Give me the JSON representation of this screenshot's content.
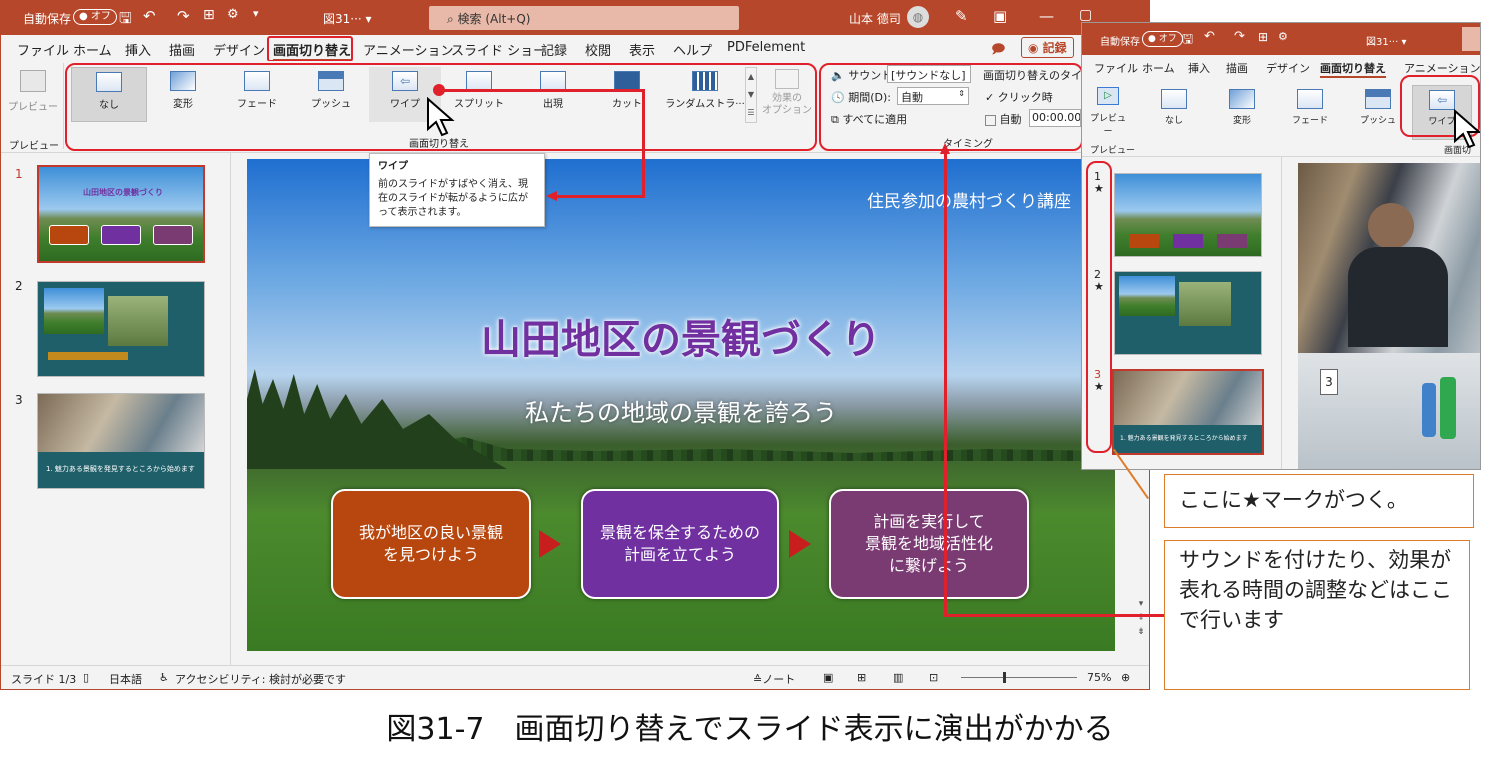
{
  "main": {
    "title_bar": {
      "autosave": "自動保存",
      "autosave_toggle": "● オフ",
      "filename": "図31··· ▾",
      "search": "検索 (Alt+Q)",
      "user": "山本 德司"
    },
    "menu": [
      "ファイル",
      "ホーム",
      "挿入",
      "描画",
      "デザイン",
      "画面切り替え",
      "アニメーション",
      "スライド ショー",
      "記録",
      "校閲",
      "表示",
      "ヘルプ",
      "PDFelement"
    ],
    "record_button": "◉ 記録",
    "ribbon": {
      "preview_label": "プレビュー",
      "preview_group": "プレビュー",
      "transitions": [
        "なし",
        "変形",
        "フェード",
        "プッシュ",
        "ワイプ",
        "スプリット",
        "出現",
        "カット",
        "ランダムストラ···"
      ],
      "effect_options": "効果の\nオプション",
      "transitions_group": "画面切り替え",
      "sound_label": "サウンド:",
      "sound_value": "[サウンドなし]",
      "duration_label": "期間(D):",
      "duration_value": "自動",
      "apply_all": "すべてに適用",
      "advance_label": "画面切り替えのタイミン",
      "on_click": "クリック時",
      "auto_label": "自動",
      "auto_value": "00:00.00",
      "timing_group": "タイミング"
    },
    "tooltip": {
      "title": "ワイプ",
      "body": "前のスライドがすばやく消え、現在のスライドが転がるように広がって表示されます。"
    },
    "slides_panel": {
      "numbers": [
        "1",
        "2",
        "3"
      ],
      "slide3_caption": "1. 魅力ある景観を発見するところから始めます"
    },
    "slide": {
      "header": "住民参加の農村づくり講座",
      "title": "山田地区の景観づくり",
      "subtitle": "私たちの地域の景観を誇ろう",
      "boxes": [
        "我が地区の良い景観\nを見つけよう",
        "景観を保全するための\n計画を立てよう",
        "計画を実行して\n景観を地域活性化\nに繋げよう"
      ]
    },
    "status_bar": {
      "slide_count": "スライド 1/3",
      "language": "日本語",
      "accessibility": "アクセシビリティ: 検討が必要です",
      "notes": "≙ノート",
      "zoom": "75%"
    }
  },
  "inset": {
    "autosave": "自動保存",
    "autosave_toggle": "● オフ",
    "filename": "図31··· ▾",
    "menu": [
      "ファイル",
      "ホーム",
      "挿入",
      "描画",
      "デザイン",
      "画面切り替え",
      "アニメーション"
    ],
    "preview_label": "プレビュー",
    "preview_group": "プレビュー",
    "transitions": [
      "なし",
      "変形",
      "フェード",
      "プッシュ",
      "ワイプ"
    ],
    "group_fragment": "画面切",
    "slide_numbers": [
      "1",
      "2",
      "3"
    ],
    "star": "★",
    "slide3_caption": "1. 魅力ある景観を発見するところから始めます"
  },
  "callouts": {
    "star_note": "ここに★マークがつく。",
    "timing_note": "サウンドを付けたり、効果が表れる時間の調整などはここで行います"
  },
  "caption": "図31-7　画面切り替えでスライド表示に演出がかかる",
  "colors": {
    "ppt_accent": "#b7472a",
    "highlight_red": "#e0202a",
    "callout_border": "#e07b2a",
    "title_purple": "#7030a0",
    "box1": "#b7470f",
    "box2": "#7030a0",
    "box3": "#7a3a72"
  }
}
